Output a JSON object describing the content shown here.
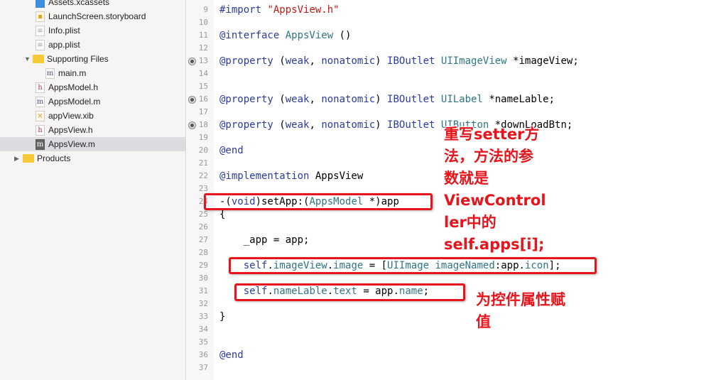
{
  "navigator": {
    "items": [
      {
        "label": "Assets.xcassets",
        "icon": "assets-icon",
        "indent": 1
      },
      {
        "label": "LaunchScreen.storyboard",
        "icon": "storyboard-icon",
        "indent": 1
      },
      {
        "label": "Info.plist",
        "icon": "plist-icon",
        "indent": 1
      },
      {
        "label": "app.plist",
        "icon": "plist-icon",
        "indent": 1
      },
      {
        "label": "Supporting Files",
        "icon": "folder-icon",
        "indent": 0,
        "expanded": true
      },
      {
        "label": "main.m",
        "icon": "m-file-icon",
        "indent": 2
      },
      {
        "label": "AppsModel.h",
        "icon": "h-file-icon",
        "indent": 1
      },
      {
        "label": "AppsModel.m",
        "icon": "m-file-icon",
        "indent": 1
      },
      {
        "label": "appView.xib",
        "icon": "xib-icon",
        "indent": 1
      },
      {
        "label": "AppsView.h",
        "icon": "h-file-icon",
        "indent": 1
      },
      {
        "label": "AppsView.m",
        "icon": "m-file-icon",
        "indent": 1,
        "selected": true
      },
      {
        "label": "Products",
        "icon": "folder-icon",
        "indent": -1,
        "expanded": false
      }
    ]
  },
  "editor": {
    "first_line": 9,
    "last_line": 37,
    "breakpoint_lines": [
      13,
      16,
      18
    ],
    "lines": {
      "9": [
        [
          "#import ",
          "pp"
        ],
        [
          "\"AppsView.h\"",
          "st"
        ]
      ],
      "11": [
        [
          "@interface ",
          "kw"
        ],
        [
          "AppsView",
          "ty"
        ],
        [
          " ()",
          ""
        ]
      ],
      "13": [
        [
          "@property ",
          "kw"
        ],
        [
          "(",
          "",
          ""
        ],
        [
          "weak",
          "kw"
        ],
        [
          ", ",
          ""
        ],
        [
          "nonatomic",
          "kw"
        ],
        [
          ") ",
          ""
        ],
        [
          "IBOutlet ",
          "kw"
        ],
        [
          "UIImageView ",
          "ty"
        ],
        [
          "*imageView;",
          ""
        ]
      ],
      "16": [
        [
          "@property ",
          "kw"
        ],
        [
          "(",
          ""
        ],
        [
          "weak",
          "kw"
        ],
        [
          ", ",
          ""
        ],
        [
          "nonatomic",
          "kw"
        ],
        [
          ") ",
          ""
        ],
        [
          "IBOutlet ",
          "kw"
        ],
        [
          "UILabel ",
          "ty"
        ],
        [
          "*nameLable;",
          ""
        ]
      ],
      "18": [
        [
          "@property ",
          "kw"
        ],
        [
          "(",
          ""
        ],
        [
          "weak",
          "kw"
        ],
        [
          ", ",
          ""
        ],
        [
          "nonatomic",
          "kw"
        ],
        [
          ") ",
          ""
        ],
        [
          "IBOutlet ",
          "kw"
        ],
        [
          "UIButton ",
          "ty"
        ],
        [
          "*downLoadBtn;",
          ""
        ]
      ],
      "20": [
        [
          "@end",
          "kw"
        ]
      ],
      "22": [
        [
          "@implementation ",
          "kw"
        ],
        [
          "AppsView",
          ""
        ]
      ],
      "24": [
        [
          "-(",
          ""
        ],
        [
          "void",
          "kw"
        ],
        [
          ")setApp:(",
          ""
        ],
        [
          "AppsModel ",
          "ty"
        ],
        [
          "*)app",
          ""
        ]
      ],
      "25": [
        [
          "{",
          ""
        ]
      ],
      "27": [
        [
          "    _app = app;",
          ""
        ]
      ],
      "29": [
        [
          "    ",
          ""
        ],
        [
          "self",
          "kw"
        ],
        [
          ".",
          ""
        ],
        [
          "imageView",
          "pr"
        ],
        [
          ".",
          ""
        ],
        [
          "image",
          "pr"
        ],
        [
          " = [",
          ""
        ],
        [
          "UIImage ",
          "ty"
        ],
        [
          "imageNamed",
          "pr"
        ],
        [
          ":app.",
          ""
        ],
        [
          "icon",
          "pr"
        ],
        [
          "];",
          ""
        ]
      ],
      "31": [
        [
          "    ",
          ""
        ],
        [
          "self",
          "kw"
        ],
        [
          ".",
          ""
        ],
        [
          "nameLable",
          "pr"
        ],
        [
          ".",
          ""
        ],
        [
          "text",
          "pr"
        ],
        [
          " = app.",
          ""
        ],
        [
          "name",
          "pr"
        ],
        [
          ";",
          ""
        ]
      ],
      "33": [
        [
          "}",
          ""
        ]
      ],
      "36": [
        [
          "@end",
          "kw"
        ]
      ]
    }
  },
  "annotations": {
    "setter_note": "重写setter方\n法，方法的参\n数就是\nViewControl\nler中的\nself.apps[i];",
    "assign_note": "为控件属性赋\n值",
    "color": "#e8141b"
  }
}
